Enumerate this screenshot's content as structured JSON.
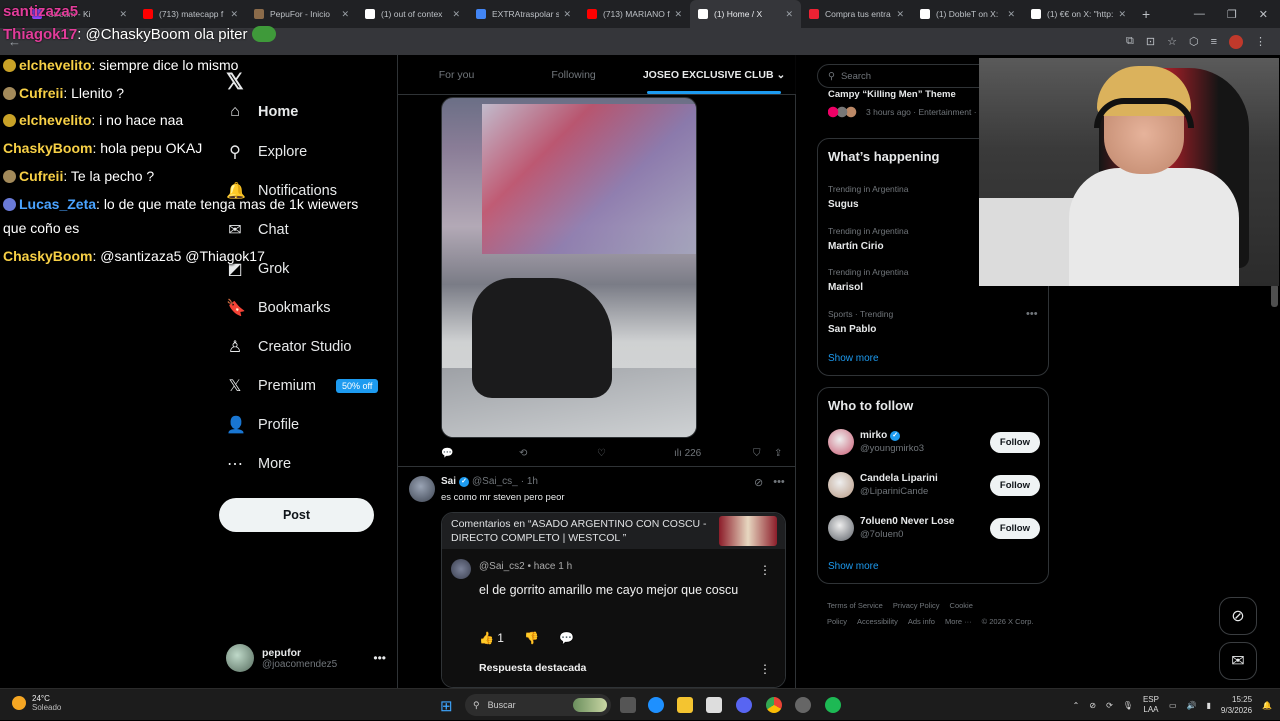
{
  "browser": {
    "tabs": [
      {
        "label": "Stream - Ki",
        "color": "#9146ff",
        "active": false
      },
      {
        "label": "(713) matecapp f",
        "color": "#ff0000",
        "active": false
      },
      {
        "label": "PepuFor - Inicio",
        "color": "#8b6b4a",
        "active": false
      },
      {
        "label": "(1) out of contex",
        "color": "#ffffff",
        "active": false
      },
      {
        "label": "EXTRAtraspolar s",
        "color": "#4285f4",
        "active": false
      },
      {
        "label": "(713) MARIANO f",
        "color": "#ff0000",
        "active": false
      },
      {
        "label": "(1) Home / X",
        "color": "#ffffff",
        "active": true
      },
      {
        "label": "Compra tus entra",
        "color": "#e23",
        "active": false
      },
      {
        "label": "(1) DobleT on X:",
        "color": "#ffffff",
        "active": false
      },
      {
        "label": "(1) €€ on X: \"http:",
        "color": "#ffffff",
        "active": false
      }
    ],
    "new_tab": "+",
    "url_fragment": "x.com/home"
  },
  "stream_chat": {
    "top_user": "santizaza5",
    "top_line_user": "Thiagok17",
    "top_line_text": ": @ChaskyBoom ola piter",
    "lines": [
      {
        "user": "elchevelito",
        "text": ": siempre dice lo mismo",
        "color": "#f7d046",
        "badge": "#c9a227"
      },
      {
        "user": "Cufreii",
        "text": ": Llenito ?",
        "color": "#f7d046",
        "badge": "#a38a5a"
      },
      {
        "user": "elchevelito",
        "text": ": i no hace naa",
        "color": "#f7d046",
        "badge": "#c9a227"
      },
      {
        "user": "ChaskyBoom",
        "text": ": hola pepu OKAJ",
        "color": "#f7d046",
        "badge": ""
      },
      {
        "user": "Cufreii",
        "text": ": Te la pecho ?",
        "color": "#f7d046",
        "badge": "#a38a5a"
      },
      {
        "user": "Lucas_Zeta",
        "text": ": lo de que mate tenga mas de 1k wiewers",
        "color": "#4aa3ff",
        "badge": "#6a7bd8"
      },
      {
        "user": "",
        "text": "que coño es",
        "color": "#ffffff",
        "badge": ""
      },
      {
        "user": "ChaskyBoom",
        "text": ": @santizaza5 @Thiagok17",
        "color": "#f7d046",
        "badge": ""
      }
    ]
  },
  "nav": {
    "items": [
      {
        "label": "Home",
        "icon": "home-icon",
        "glyph": "⌂"
      },
      {
        "label": "Explore",
        "icon": "search-icon",
        "glyph": "⚲"
      },
      {
        "label": "Notifications",
        "icon": "bell-icon",
        "glyph": "🔔"
      },
      {
        "label": "Chat",
        "icon": "chat-icon",
        "glyph": "✉"
      },
      {
        "label": "Grok",
        "icon": "grok-icon",
        "glyph": "◩"
      },
      {
        "label": "Bookmarks",
        "icon": "bookmark-icon",
        "glyph": "🔖"
      },
      {
        "label": "Creator Studio",
        "icon": "creator-studio-icon",
        "glyph": "♙"
      },
      {
        "label": "Premium",
        "icon": "x-premium-icon",
        "glyph": "𝕏"
      },
      {
        "label": "Profile",
        "icon": "profile-icon",
        "glyph": "👤"
      },
      {
        "label": "More",
        "icon": "more-icon",
        "glyph": "⋯"
      }
    ],
    "premium_badge": "50% off",
    "post_label": "Post",
    "account": {
      "name": "pepufor",
      "handle": "@joacomendez5"
    }
  },
  "timeline": {
    "tabs": [
      "For you",
      "Following",
      "JOSEO EXCLUSIVE CLUB"
    ],
    "tweet1": {
      "views": "226"
    },
    "tweet2": {
      "name": "Sai",
      "handle": "@Sai_cs_",
      "time": "· 1h",
      "text": "es como mr steven pero peor",
      "card": {
        "title": "Comentarios en “ASADO ARGENTINO CON COSCU - DIRECTO COMPLETO | WESTCOL ”",
        "comment_user": "@Sai_cs2 • hace 1 h",
        "comment_text": "el de gorrito amarillo me cayo mejor que coscu",
        "likes": "1",
        "featured": "Respuesta destacada"
      }
    }
  },
  "sidebar": {
    "search_placeholder": "Search",
    "top_clip": "Campy “Killing Men” Theme",
    "top_clip_meta": "3 hours ago · Entertainment ·",
    "happening_title": "What’s happening",
    "trends": [
      {
        "context": "Trending in Argentina",
        "name": "Sugus"
      },
      {
        "context": "Trending in Argentina",
        "name": "Martín Cirio"
      },
      {
        "context": "Trending in Argentina",
        "name": "Marisol"
      },
      {
        "context": "Sports · Trending",
        "name": "San Pablo"
      }
    ],
    "show_more": "Show more",
    "who_title": "Who to follow",
    "follow": [
      {
        "name": "mirko",
        "handle": "@youngmirko3",
        "verified": true,
        "color": "#c95a72"
      },
      {
        "name": "Candela Liparini",
        "handle": "@LipariniCande",
        "verified": false,
        "color": "#b89a84"
      },
      {
        "name": "7oluen0 Never Lose",
        "handle": "@7oluen0",
        "verified": false,
        "color": "#5a5f66"
      }
    ],
    "follow_label": "Follow",
    "footer": [
      "Terms of Service",
      "Privacy Policy",
      "Cookie Policy",
      "Accessibility",
      "Ads info",
      "More ···",
      "© 2026 X Corp."
    ]
  },
  "taskbar": {
    "temp": "24°C",
    "weather": "Soleado",
    "search_placeholder": "Buscar",
    "lang1": "ESP",
    "lang2": "LAA",
    "time": "15:25",
    "date": "9/3/2026"
  }
}
